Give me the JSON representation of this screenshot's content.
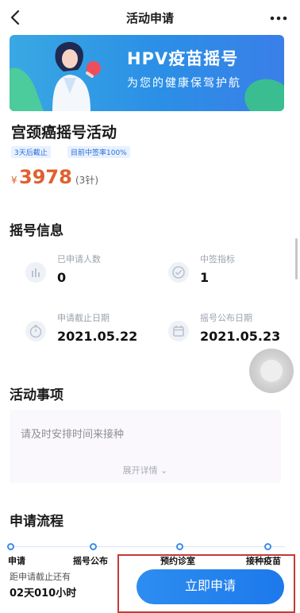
{
  "navbar": {
    "title": "活动申请",
    "back_icon": "chevron-left-icon",
    "more_icon": "more-dots-icon"
  },
  "banner": {
    "title": "HPV疫苗摇号",
    "subtitle": "为您的健康保驾护航"
  },
  "event": {
    "title": "宫颈癌摇号活动",
    "tags": [
      "3天后截止",
      "目前中签率100%"
    ],
    "currency": "¥",
    "price": "3978",
    "price_note": "(3针)"
  },
  "info": {
    "section_title": "摇号信息",
    "stats": [
      {
        "label": "已申请人数",
        "value": "0",
        "icon": "bar-chart-icon"
      },
      {
        "label": "中签指标",
        "value": "1",
        "icon": "check-circle-icon"
      },
      {
        "label": "申请截止日期",
        "value": "2021.05.22",
        "icon": "stopwatch-icon"
      },
      {
        "label": "摇号公布日期",
        "value": "2021.05.23",
        "icon": "calendar-icon"
      }
    ]
  },
  "notice": {
    "section_title": "活动事项",
    "text": "请及时安排时间来接种",
    "expand_label": "展开详情 ⌄"
  },
  "process": {
    "section_title": "申请流程",
    "steps": [
      "申请",
      "摇号公布",
      "预约诊室",
      "接种疫苗"
    ]
  },
  "footer": {
    "countdown_label": "距申请截止还有",
    "countdown_value": "02天010小时",
    "apply_label": "立即申请"
  },
  "colors": {
    "accent": "#1d79eb",
    "price": "#e0602f",
    "highlight_frame": "#c33a35"
  }
}
